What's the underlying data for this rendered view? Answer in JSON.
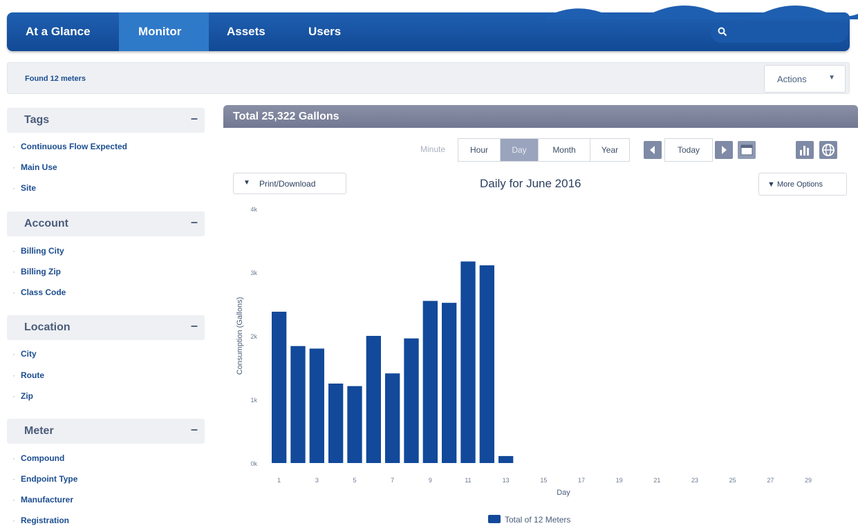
{
  "nav": {
    "tabs": [
      {
        "label": "At a Glance",
        "active": false
      },
      {
        "label": "Monitor",
        "active": true
      },
      {
        "label": "Assets",
        "active": false
      },
      {
        "label": "Users",
        "active": false
      }
    ],
    "search_icon": "search-icon"
  },
  "status": {
    "found_text": "Found 12 meters",
    "actions_label": "Actions"
  },
  "sidebar": {
    "tags": {
      "title": "Tags",
      "items": [
        "Continuous Flow Expected",
        "Main Use",
        "Site"
      ]
    },
    "account": {
      "title": "Account",
      "items": [
        "Billing City",
        "Billing Zip",
        "Class Code"
      ]
    },
    "location": {
      "title": "Location",
      "items": [
        "City",
        "Route",
        "Zip"
      ]
    },
    "meter": {
      "title": "Meter",
      "items": [
        "Compound",
        "Endpoint Type",
        "Manufacturer",
        "Registration"
      ]
    },
    "collapse_symbol": "–"
  },
  "panel": {
    "title": "Total 25,322 Gallons",
    "periods": [
      "Minute",
      "Hour",
      "Day",
      "Month",
      "Year"
    ],
    "selected_period": "Day",
    "today_label": "Today",
    "print_label": "Print/Download",
    "subtitle": "Daily for June 2016",
    "more_options_label": "More Options",
    "caret": "▼"
  },
  "colors": {
    "nav_blue": "#1a55a6",
    "bar_blue": "#12499a",
    "panel_header": "#7d839b",
    "sidebar_text": "#1b4d8f"
  },
  "chart_data": {
    "type": "bar",
    "title": "Daily for June 2016",
    "xlabel": "Day",
    "ylabel": "Consumption (Gallons)",
    "ytick_labels": [
      "0k",
      "1k",
      "2k",
      "3k",
      "4k"
    ],
    "xtick_labels": [
      "1",
      "3",
      "5",
      "7",
      "9",
      "11",
      "13",
      "15",
      "17",
      "19",
      "21",
      "23",
      "25",
      "27",
      "29"
    ],
    "ylim": [
      0,
      4000
    ],
    "categories": [
      1,
      2,
      3,
      4,
      5,
      6,
      7,
      8,
      9,
      10,
      11,
      12,
      13,
      14,
      15,
      16,
      17,
      18,
      19,
      20,
      21,
      22,
      23,
      24,
      25,
      26,
      27,
      28,
      29,
      30
    ],
    "series": [
      {
        "name": "Total of 12 Meters",
        "values": [
          2380,
          1840,
          1800,
          1250,
          1210,
          2000,
          1410,
          1960,
          2550,
          2520,
          3170,
          3110,
          110,
          null,
          null,
          null,
          null,
          null,
          null,
          null,
          null,
          null,
          null,
          null,
          null,
          null,
          null,
          null,
          null,
          null
        ]
      }
    ],
    "legend": "bottom-center",
    "grid": false
  }
}
